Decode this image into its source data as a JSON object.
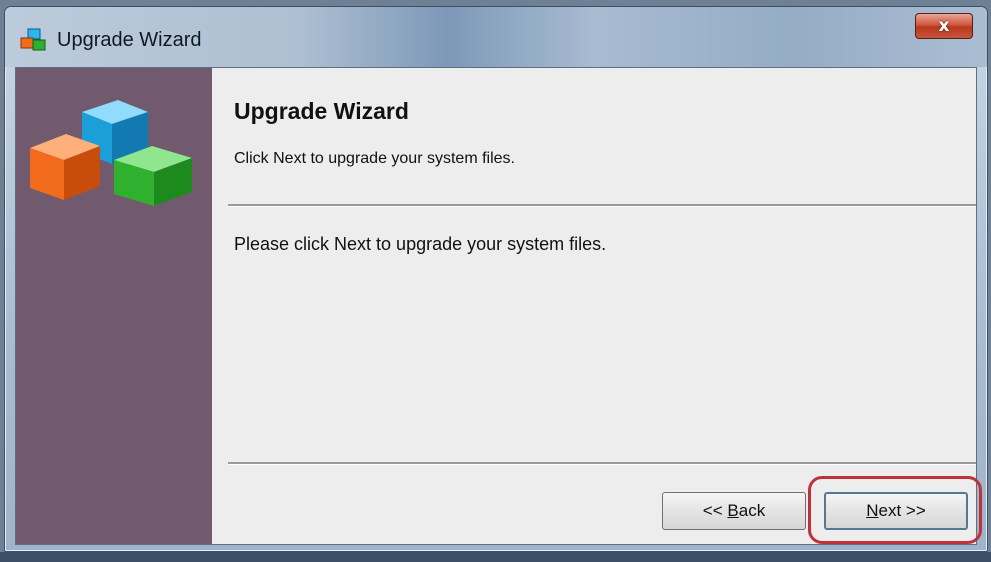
{
  "window": {
    "title": "Upgrade Wizard",
    "close_label": "x"
  },
  "header": {
    "title": "Upgrade Wizard",
    "subtitle": "Click Next to upgrade your system files."
  },
  "content": {
    "message": "Please click Next to upgrade your system files."
  },
  "buttons": {
    "back_prefix": "<< ",
    "back_mnemonic": "B",
    "back_rest": "ack",
    "next_mnemonic": "N",
    "next_rest": "ext >>"
  },
  "colors": {
    "sidebar": "#715a6d",
    "highlight": "#c0323a",
    "cube_orange": "#f26a1b",
    "cube_blue": "#2bb6f0",
    "cube_green": "#2fb12f"
  },
  "icons": {
    "app": "wizard-cubes-icon",
    "close": "close-icon",
    "logo": "wizard-cubes-logo"
  }
}
